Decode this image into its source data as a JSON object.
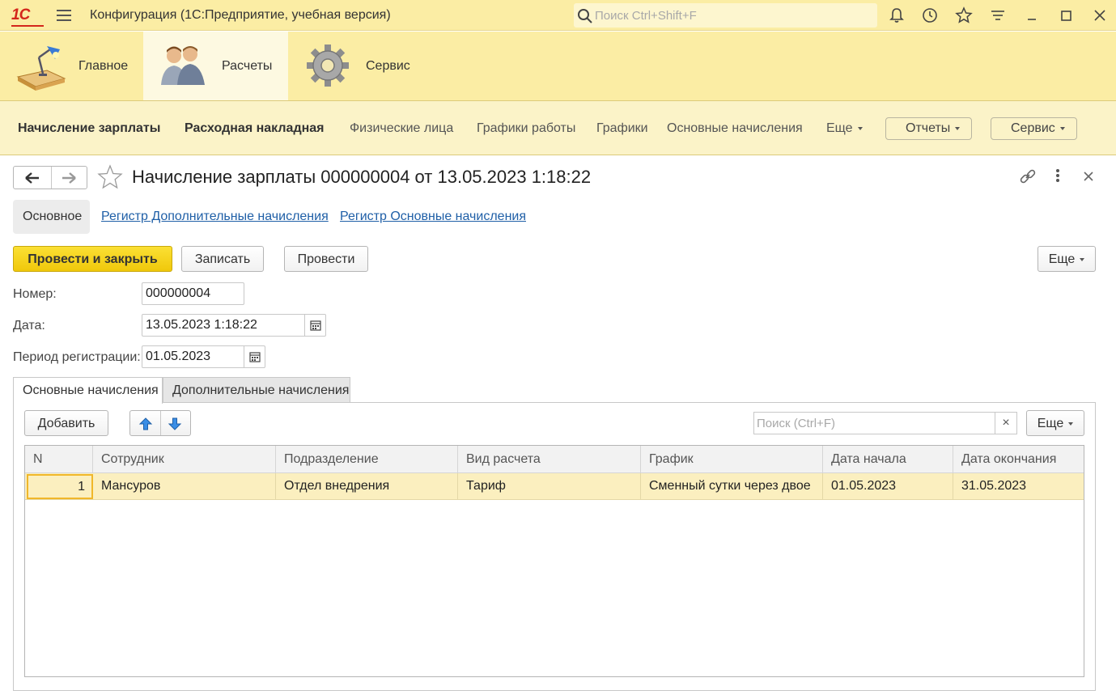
{
  "titlebar": {
    "logo": "1С",
    "app_title": "Конфигурация  (1С:Предприятие, учебная версия)",
    "search_placeholder": "Поиск Ctrl+Shift+F"
  },
  "sections": [
    {
      "label": "Главное",
      "icon": "desk-lamp-icon"
    },
    {
      "label": "Расчеты",
      "icon": "people-icon",
      "active": true
    },
    {
      "label": "Сервис",
      "icon": "gear-icon"
    }
  ],
  "funcbar": {
    "items": [
      "Начисление зарплаты",
      "Расходная накладная",
      "Физические лица",
      "Графики работы",
      "Графики",
      "Основные начисления"
    ],
    "more": "Еще",
    "reports": "Отчеты",
    "service": "Сервис"
  },
  "form": {
    "title": "Начисление зарплаты 000000004 от 13.05.2023 1:18:22",
    "nav_tabs": {
      "main": "Основное",
      "link1": "Регистр Дополнительные начисления",
      "link2": "Регистр Основные начисления"
    },
    "buttons": {
      "post_close": "Провести и закрыть",
      "save": "Записать",
      "post": "Провести",
      "more": "Еще"
    },
    "fields": {
      "number_label": "Номер:",
      "number_value": "000000004",
      "date_label": "Дата:",
      "date_value": "13.05.2023  1:18:22",
      "period_label": "Период регистрации:",
      "period_value": "01.05.2023"
    },
    "tabs": {
      "main": "Основные начисления",
      "additional": "Дополнительные начисления"
    },
    "table_toolbar": {
      "add": "Добавить",
      "search_placeholder": "Поиск (Ctrl+F)",
      "clear": "×",
      "more": "Еще"
    },
    "table": {
      "columns": [
        "N",
        "Сотрудник",
        "Подразделение",
        "Вид расчета",
        "График",
        "Дата начала",
        "Дата окончания"
      ],
      "rows": [
        [
          "1",
          "Мансуров",
          "Отдел внедрения",
          "Тариф",
          "Сменный сутки через двое",
          "01.05.2023",
          "31.05.2023"
        ]
      ]
    }
  },
  "colors": {
    "header_bg": "#fbeda4",
    "funcbar_bg": "#fbf3c8",
    "primary_button": "#f5d316",
    "selected_row": "#fbefbf",
    "link": "#1f5fa7"
  }
}
